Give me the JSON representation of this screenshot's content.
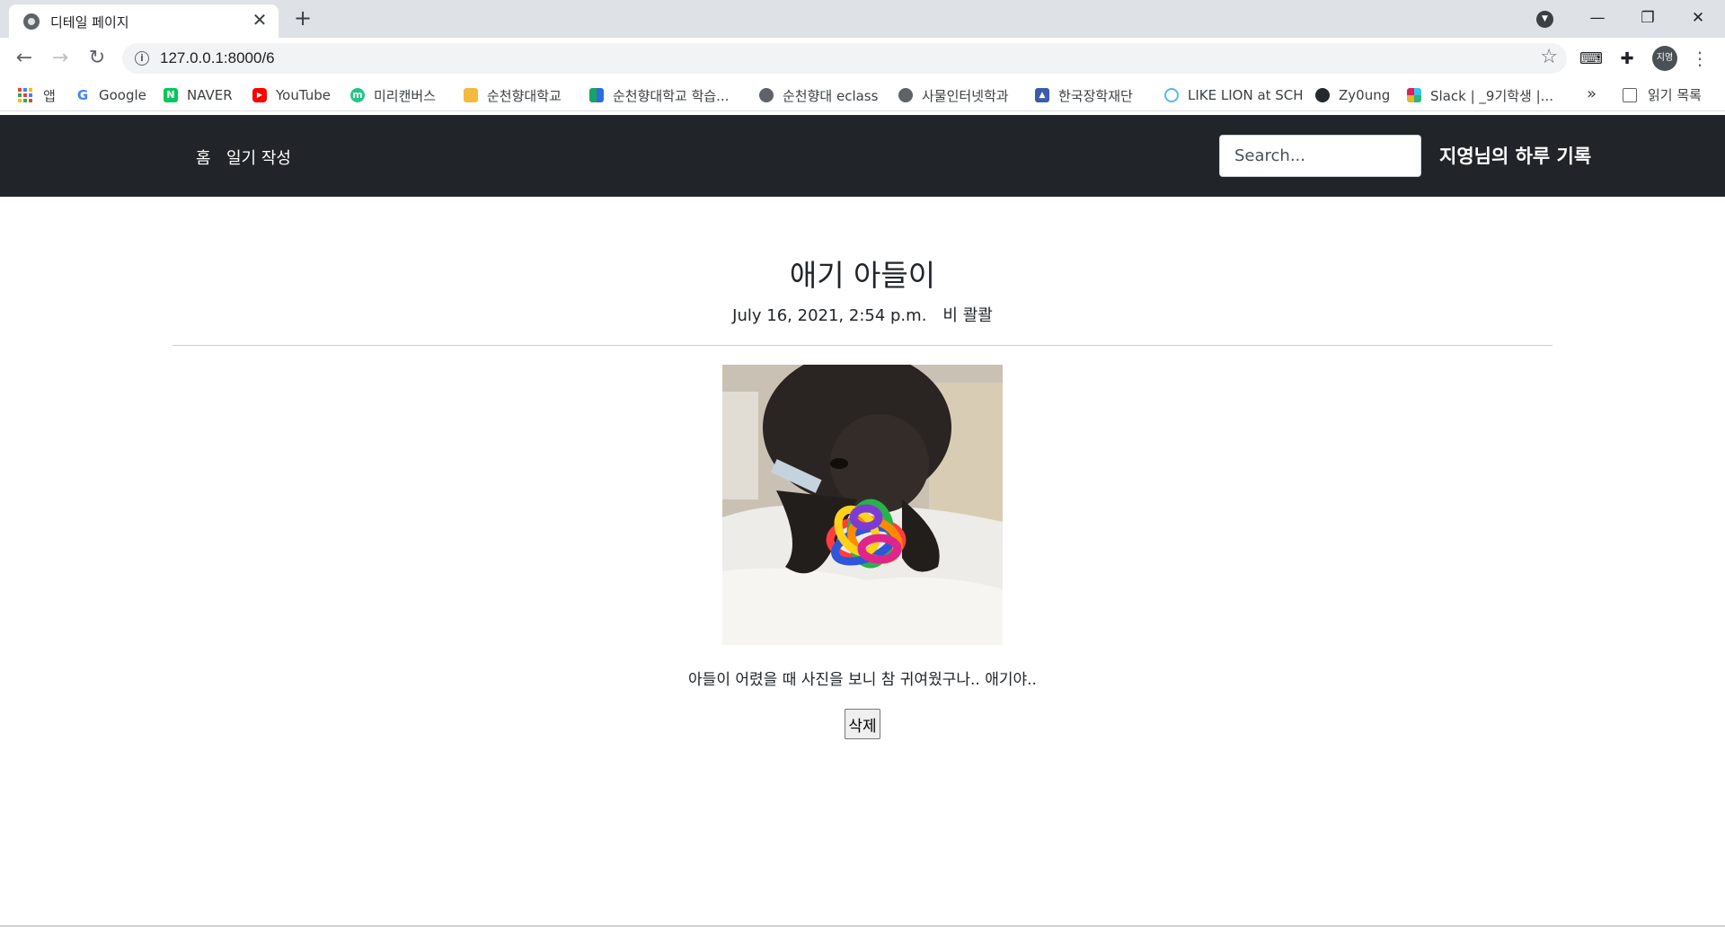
{
  "browser": {
    "tab_title": "디테일 페이지",
    "tab_close": "✕",
    "new_tab": "+",
    "url": "127.0.0.1:8000/6",
    "window_controls": {
      "minimize": "—",
      "restore": "❐",
      "close": "✕"
    },
    "nav": {
      "back": "←",
      "forward": "→",
      "reload": "↻"
    },
    "profile_initials": "지영",
    "bookmarks": [
      {
        "label": "앱",
        "icon": "apps-grid-icon"
      },
      {
        "label": "Google",
        "icon": "google-icon",
        "color": "#4285f4"
      },
      {
        "label": "NAVER",
        "icon": "naver-icon",
        "color": "#03c75a"
      },
      {
        "label": "YouTube",
        "icon": "youtube-icon",
        "color": "#ff0000"
      },
      {
        "label": "미리캔버스",
        "icon": "miricanvas-icon",
        "color": "#21c685"
      },
      {
        "label": "순천향대학교",
        "icon": "sch-icon",
        "color": "#f5b93d"
      },
      {
        "label": "순천향대학교 학습...",
        "icon": "sch-learning-icon",
        "color": "#1aa260"
      },
      {
        "label": "순천향대 eclass",
        "icon": "globe-icon",
        "color": "#5f6368"
      },
      {
        "label": "사물인터넷학과",
        "icon": "globe-icon",
        "color": "#5f6368"
      },
      {
        "label": "한국장학재단",
        "icon": "kosaf-icon",
        "color": "#3b5bab"
      },
      {
        "label": "LIKE LION at SCH",
        "icon": "likelion-icon",
        "color": "#5ab9e8"
      },
      {
        "label": "Zy0ung",
        "icon": "github-icon",
        "color": "#24292e"
      },
      {
        "label": "Slack | _9기학생 |...",
        "icon": "slack-icon",
        "color": "#e01e5a"
      }
    ],
    "bookmarks_more": "»",
    "reading_list": "읽기 목록"
  },
  "site": {
    "nav_home": "홈",
    "nav_write": "일기 작성",
    "search_placeholder": "Search...",
    "brand": "지영님의 하루 기록"
  },
  "post": {
    "title": "애기 아들이",
    "date": "July 16, 2021, 2:54 p.m.",
    "weather": "비 콸콸",
    "body": "아들이 어렸을 때 사진을 보니 참 귀여웠구나.. 애기야..",
    "delete_label": "삭제"
  }
}
